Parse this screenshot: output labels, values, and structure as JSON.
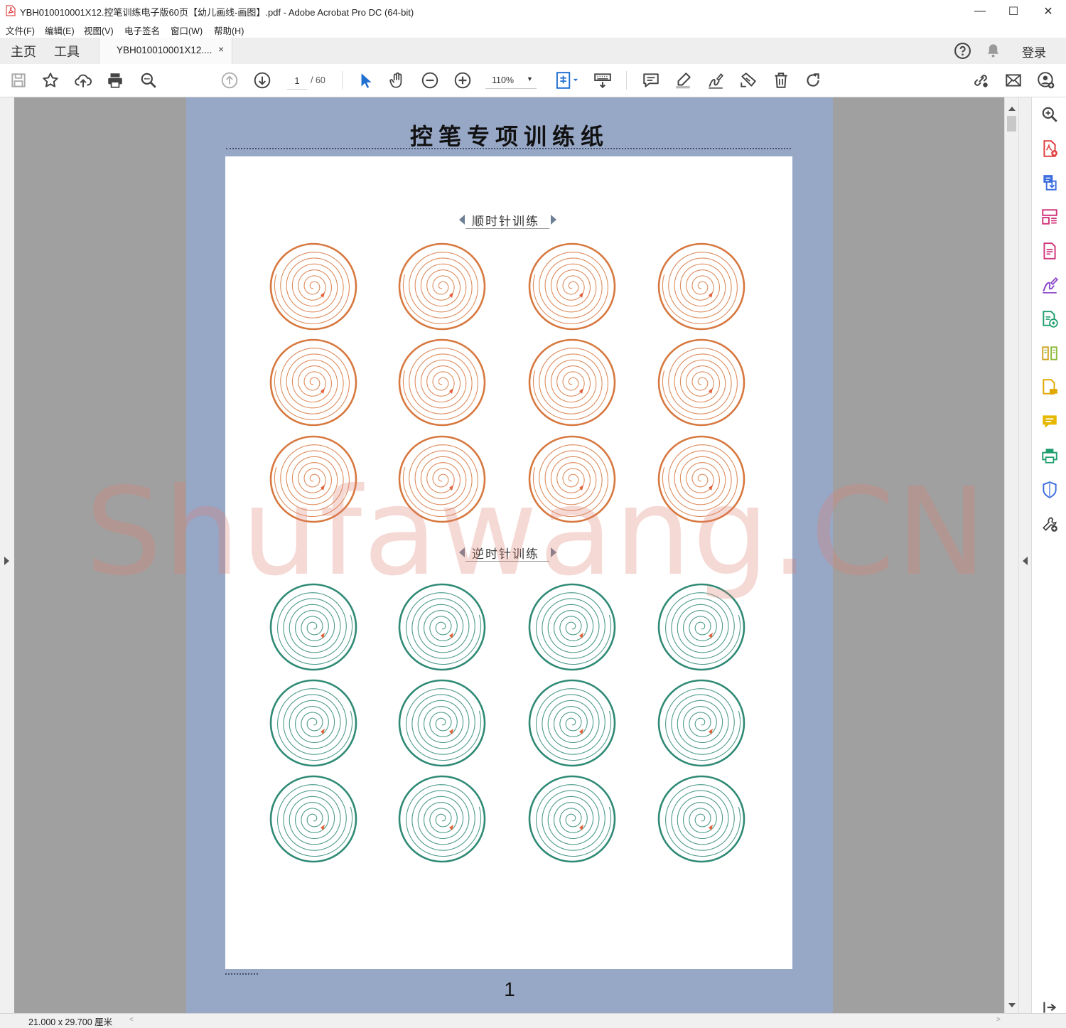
{
  "window": {
    "title": "YBH010010001X12.控笔训练电子版60页【幼儿画线-画图】.pdf - Adobe Acrobat Pro DC (64-bit)",
    "minimize": "—",
    "maximize": "☐",
    "close": "✕"
  },
  "menu": {
    "items": [
      "文件(F)",
      "编辑(E)",
      "视图(V)",
      "电子签名",
      "窗口(W)",
      "帮助(H)"
    ]
  },
  "tabs": {
    "home": "主页",
    "tools": "工具",
    "document": "YBH010010001X12....",
    "close": "×",
    "login": "登录"
  },
  "toolbar": {
    "page_current": "1",
    "page_total": "/ 60",
    "zoom": "110%"
  },
  "document": {
    "title": "控笔专项训练纸",
    "section_clockwise": "顺时针训练",
    "section_counterclockwise": "逆时针训练",
    "page_number": "1",
    "watermark": "Shufawang.CN",
    "colors": {
      "clockwise": "#d7783f",
      "counterclockwise": "#2f8a75",
      "page_border": "#97a7c6",
      "start_marker": "#e0603a"
    },
    "grid": {
      "rows_per_section": 3,
      "cols": 4
    }
  },
  "statusbar": {
    "page_size": "21.000 x 29.700 厘米"
  },
  "icons": {
    "toolbar": [
      "save-icon",
      "bookmark-star-icon",
      "upload-cloud-icon",
      "print-icon",
      "zoom-search-icon",
      "page-up-icon",
      "page-down-icon",
      "select-cursor-icon",
      "hand-icon",
      "zoom-out-icon",
      "zoom-in-icon",
      "page-layout-icon",
      "keyboard-icon",
      "comment-icon",
      "highlight-icon",
      "sign-icon",
      "stamp-icon",
      "delete-icon",
      "rotate-icon",
      "share-link-icon",
      "email-icon",
      "add-user-icon"
    ],
    "right_panel": [
      "search-zoom-icon",
      "create-pdf-icon",
      "export-pdf-icon",
      "organize-pages-icon",
      "edit-pdf-icon",
      "fill-sign-icon",
      "combine-files-icon",
      "compare-icon",
      "send-review-icon",
      "comment-icon",
      "print-production-icon",
      "protect-icon",
      "more-tools-icon"
    ]
  }
}
